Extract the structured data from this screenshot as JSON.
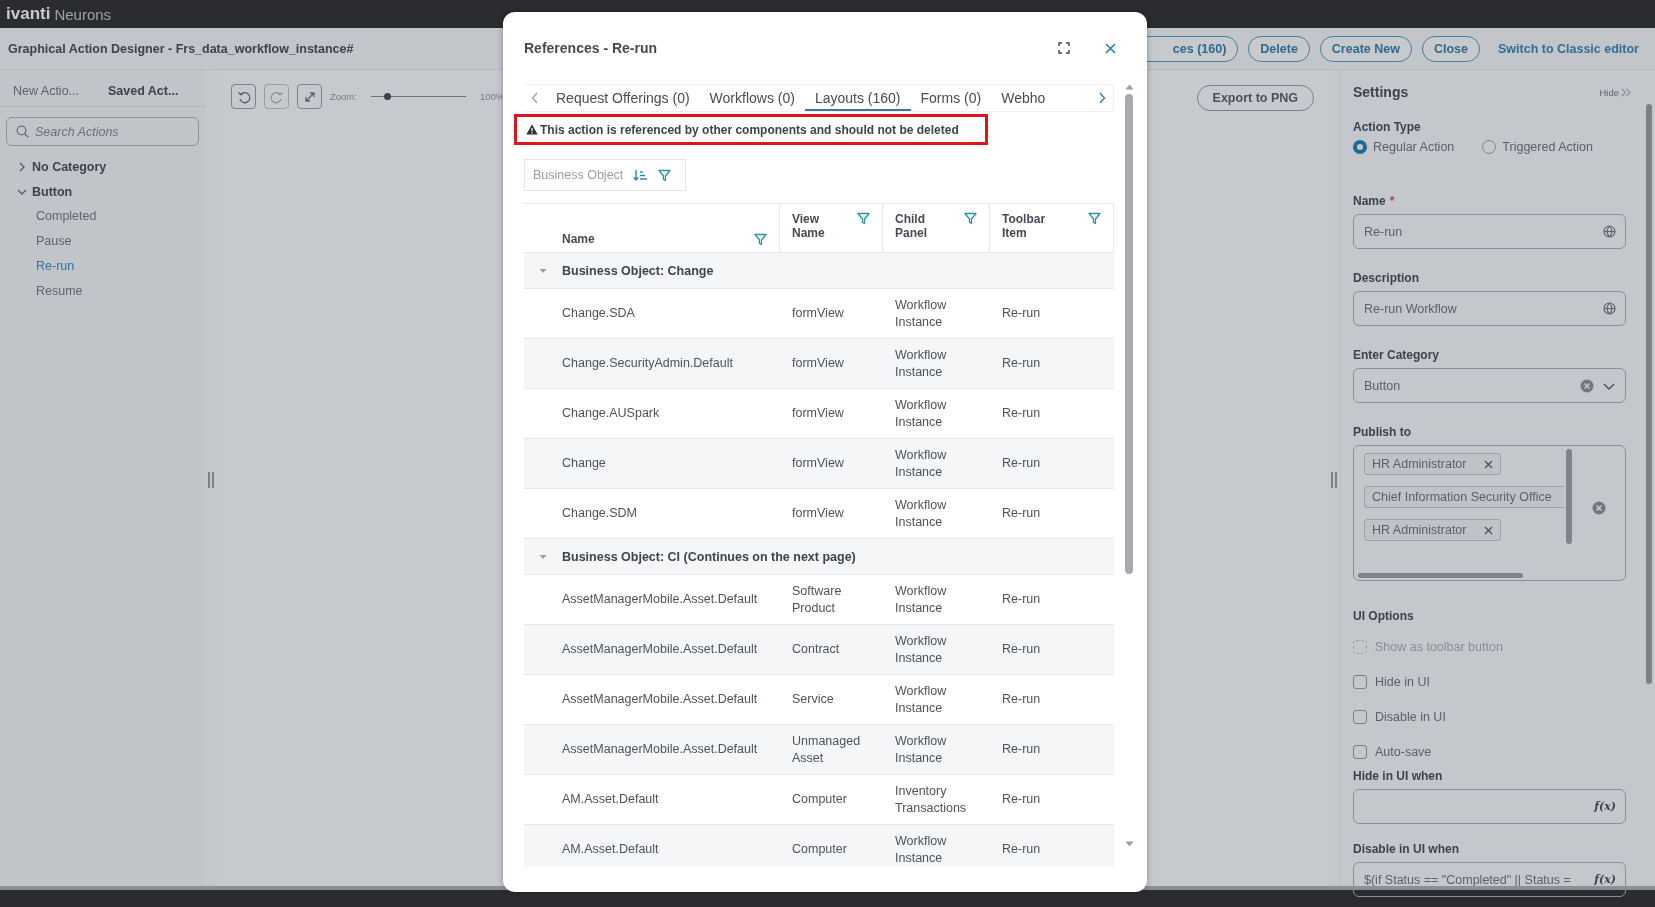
{
  "app_bar": {
    "brand": "ivanti",
    "product": "Neurons"
  },
  "header": {
    "title": "Graphical Action Designer - Frs_data_workflow_instance#",
    "buttons": [
      {
        "label": "ces (160)"
      },
      {
        "label": "Delete"
      },
      {
        "label": "Create New"
      },
      {
        "label": "Close"
      }
    ],
    "link": "Switch to Classic editor"
  },
  "sidebar": {
    "tabs": [
      {
        "label": "New Actio...",
        "selected": false
      },
      {
        "label": "Saved Act...",
        "selected": true
      }
    ],
    "search": {
      "placeholder": "Search Actions"
    },
    "tree": [
      {
        "label": "No Category",
        "expanded": false
      },
      {
        "label": "Button",
        "expanded": true,
        "children": [
          {
            "label": "Completed",
            "selected": false
          },
          {
            "label": "Pause",
            "selected": false
          },
          {
            "label": "Re-run",
            "selected": true
          },
          {
            "label": "Resume",
            "selected": false
          }
        ]
      }
    ]
  },
  "canvas": {
    "tools": [
      {
        "kind": "undo",
        "disabled": false
      },
      {
        "kind": "redo",
        "disabled": true
      },
      {
        "kind": "fit",
        "disabled": false
      }
    ],
    "zoom_label": "Zoom:",
    "zoom": {
      "level": 0.17
    },
    "zoom_reading": "100%",
    "export_button": "Export to PNG"
  },
  "settings": {
    "title": "Settings",
    "hide_link": "Hide",
    "action_type": {
      "label": "Action Type",
      "options": [
        {
          "label": "Regular Action",
          "selected": true
        },
        {
          "label": "Triggered Action",
          "selected": false
        }
      ]
    },
    "fields": [
      {
        "kind": "text",
        "label": "Name",
        "required_mark": "*",
        "value": "Re-run"
      },
      {
        "kind": "text",
        "label": "Description",
        "value": "Re-run Workflow"
      },
      {
        "kind": "select",
        "label": "Enter Category",
        "value": "Button"
      }
    ],
    "publish_to": {
      "label": "Publish to",
      "tags": [
        {
          "label": "HR Administrator",
          "removable": true
        },
        {
          "label": "Chief Information Security Office",
          "removable": false
        },
        {
          "label": "HR Administrator",
          "removable": true
        }
      ]
    },
    "ui_options": {
      "label": "UI Options",
      "options": [
        {
          "label": "Show as toolbar button",
          "checked": false,
          "disabled": true
        },
        {
          "label": "Hide in UI",
          "checked": false,
          "disabled": false
        },
        {
          "label": "Disable in UI",
          "checked": false,
          "disabled": false
        },
        {
          "label": "Auto-save",
          "checked": false,
          "disabled": false
        }
      ]
    },
    "expressions": [
      {
        "label": "Hide in UI when",
        "fx": "f(x)"
      },
      {
        "label": "Disable in UI when",
        "value": "$(if Status == \"Completed\" || Status =",
        "fx": "f(x)"
      }
    ]
  },
  "dialog": {
    "title": "References - Re-run",
    "tabs": [
      {
        "label": "Request Offerings (0)",
        "selected": false
      },
      {
        "label": "Workflows (0)",
        "selected": false
      },
      {
        "label": "Layouts (160)",
        "selected": true
      },
      {
        "label": "Forms (0)",
        "selected": false
      },
      {
        "label": "Webho",
        "selected": false
      }
    ],
    "warning": "This action is referenced by other components and should not be deleted",
    "group_chip": "Business Object",
    "table": {
      "columns": [
        "Name",
        "View Name",
        "Child Panel",
        "Toolbar Item"
      ],
      "rows": [
        {
          "kind": "group",
          "label": "Business Object: Change",
          "expanded": true
        },
        {
          "kind": "item",
          "cells": [
            "Change.SDA",
            "formView",
            "Workflow Instance",
            "Re-run"
          ]
        },
        {
          "kind": "item",
          "cells": [
            "Change.SecurityAdmin.Default",
            "formView",
            "Workflow Instance",
            "Re-run"
          ]
        },
        {
          "kind": "item",
          "cells": [
            "Change.AUSpark",
            "formView",
            "Workflow Instance",
            "Re-run"
          ]
        },
        {
          "kind": "item",
          "cells": [
            "Change",
            "formView",
            "Workflow Instance",
            "Re-run"
          ]
        },
        {
          "kind": "item",
          "cells": [
            "Change.SDM",
            "formView",
            "Workflow Instance",
            "Re-run"
          ]
        },
        {
          "kind": "group",
          "label": "Business Object: CI (Continues on the next page)",
          "expanded": true
        },
        {
          "kind": "item",
          "cells": [
            "AssetManagerMobile.Asset.Default",
            "Software Product",
            "Workflow Instance",
            "Re-run"
          ]
        },
        {
          "kind": "item",
          "cells": [
            "AssetManagerMobile.Asset.Default",
            "Contract",
            "Workflow Instance",
            "Re-run"
          ]
        },
        {
          "kind": "item",
          "cells": [
            "AssetManagerMobile.Asset.Default",
            "Service",
            "Workflow Instance",
            "Re-run"
          ]
        },
        {
          "kind": "item",
          "cells": [
            "AssetManagerMobile.Asset.Default",
            "Unmanaged Asset",
            "Workflow Instance",
            "Re-run"
          ]
        },
        {
          "kind": "item",
          "cells": [
            "AM.Asset.Default",
            "Computer",
            "Inventory Transactions",
            "Re-run"
          ]
        },
        {
          "kind": "item",
          "cells": [
            "AM.Asset.Default",
            "Computer",
            "Workflow Instance",
            "Re-run"
          ]
        }
      ]
    }
  }
}
